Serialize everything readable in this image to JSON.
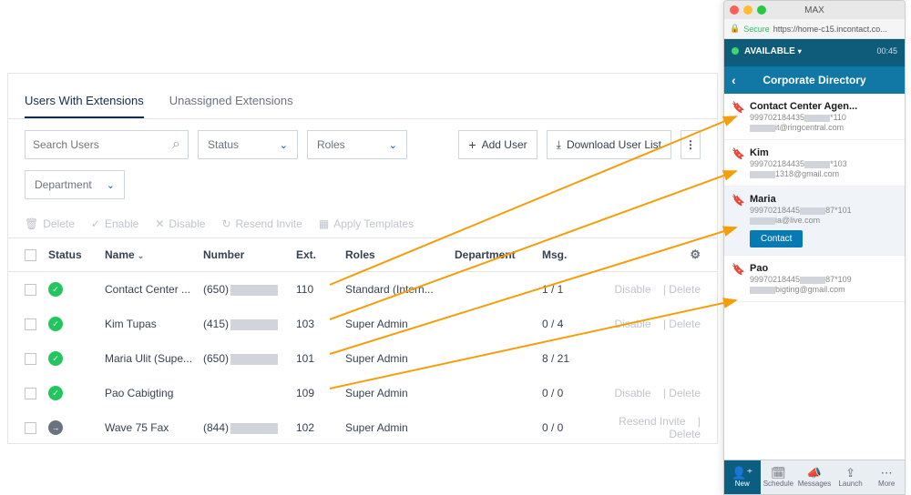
{
  "tabs": {
    "users_ext": "Users With Extensions",
    "unassigned": "Unassigned Extensions"
  },
  "filters": {
    "search_placeholder": "Search Users",
    "status_label": "Status",
    "roles_label": "Roles",
    "dept_label": "Department",
    "add_user": "Add User",
    "download": "Download User List",
    "more": "⋮"
  },
  "bulk": {
    "delete": "Delete",
    "enable": "Enable",
    "disable": "Disable",
    "resend": "Resend Invite",
    "apply_tpl": "Apply Templates"
  },
  "thead": {
    "status": "Status",
    "name": "Name",
    "number": "Number",
    "ext": "Ext.",
    "roles": "Roles",
    "dept": "Department",
    "msg": "Msg."
  },
  "rows": [
    {
      "status": "green",
      "name": "Contact Center ...",
      "prefix": "(650)",
      "ext": "110",
      "role": "Standard (Intern...",
      "msg": "1 / 1",
      "a1": "Disable",
      "a2": "Delete"
    },
    {
      "status": "green",
      "name": "Kim Tupas",
      "prefix": "(415)",
      "ext": "103",
      "role": "Super Admin",
      "msg": "0 / 4",
      "a1": "Disable",
      "a2": "Delete"
    },
    {
      "status": "green",
      "name": "Maria Ulit (Supe...",
      "prefix": "(650)",
      "ext": "101",
      "role": "Super Admin",
      "msg": "8 / 21",
      "a1": "",
      "a2": ""
    },
    {
      "status": "green",
      "name": "Pao Cabigting",
      "prefix": "",
      "ext": "109",
      "role": "Super Admin",
      "msg": "0 / 0",
      "a1": "Disable",
      "a2": "Delete"
    },
    {
      "status": "gray",
      "name": "Wave 75 Fax",
      "prefix": "(844)",
      "ext": "102",
      "role": "Super Admin",
      "msg": "0 / 0",
      "a1": "Resend Invite",
      "a2": "Delete"
    }
  ],
  "max": {
    "window_title": "MAX",
    "secure": "Secure",
    "url": "https://home-c15.incontact.co...",
    "available": "AVAILABLE",
    "timer": "00:45",
    "dir_title": "Corporate Directory",
    "contact_btn": "Contact",
    "contacts": [
      {
        "name": "Contact Center Agen...",
        "phone_a": "999702184435",
        "phone_b": "*110",
        "email_b": "it@ringcentral.com"
      },
      {
        "name": "Kim",
        "phone_a": "999702184435",
        "phone_b": "*103",
        "email_b": "1318@gmail.com"
      },
      {
        "name": "Maria",
        "phone_a": "99970218445",
        "phone_b": "87*101",
        "email_b": "ia@live.com"
      },
      {
        "name": "Pao",
        "phone_a": "99970218445",
        "phone_b": "87*109",
        "email_b": "bigting@gmail.com"
      }
    ],
    "footer": {
      "new": "New",
      "schedule": "Schedule",
      "messages": "Messages",
      "launch": "Launch",
      "more": "More"
    }
  }
}
